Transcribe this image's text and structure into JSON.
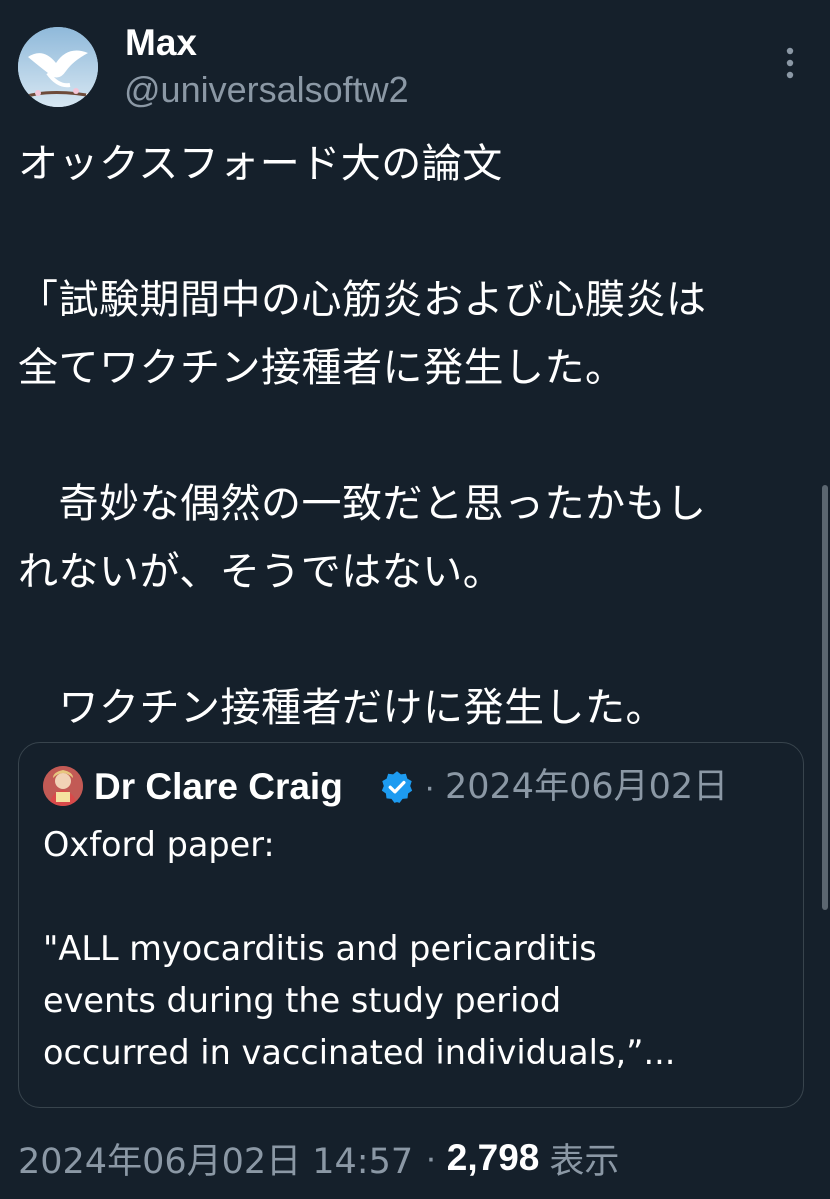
{
  "post": {
    "user": {
      "name": "Max",
      "handle": "@universalsoftw2"
    },
    "body_lines": [
      "オックスフォード大の論文",
      "",
      "「試験期間中の心筋炎および心膜炎は",
      "全てワクチン接種者に発生した。",
      "",
      "　奇妙な偶然の一致だと思ったかもし",
      "れないが、そうではない。",
      "",
      "　ワクチン接種者だけに発生した。"
    ],
    "quote": {
      "author": "Dr Clare Craig",
      "separator": "·",
      "date": "2024年06月02日",
      "text_lines": [
        "Oxford paper:",
        "",
        "\"ALL myocarditis and pericarditis",
        "events during the study period",
        "occurred in vaccinated individuals,”..."
      ]
    },
    "meta": {
      "timestamp": "2024年06月02日 14:57",
      "separator": "·",
      "views_count": "2,798",
      "views_label": "表示"
    }
  },
  "icons": {
    "more": "more-vertical-icon",
    "verified": "verified-badge-icon"
  },
  "colors": {
    "background": "#15202b",
    "secondary_text": "#8b98a5",
    "border": "#38444d",
    "verified": "#1d9bf0"
  }
}
